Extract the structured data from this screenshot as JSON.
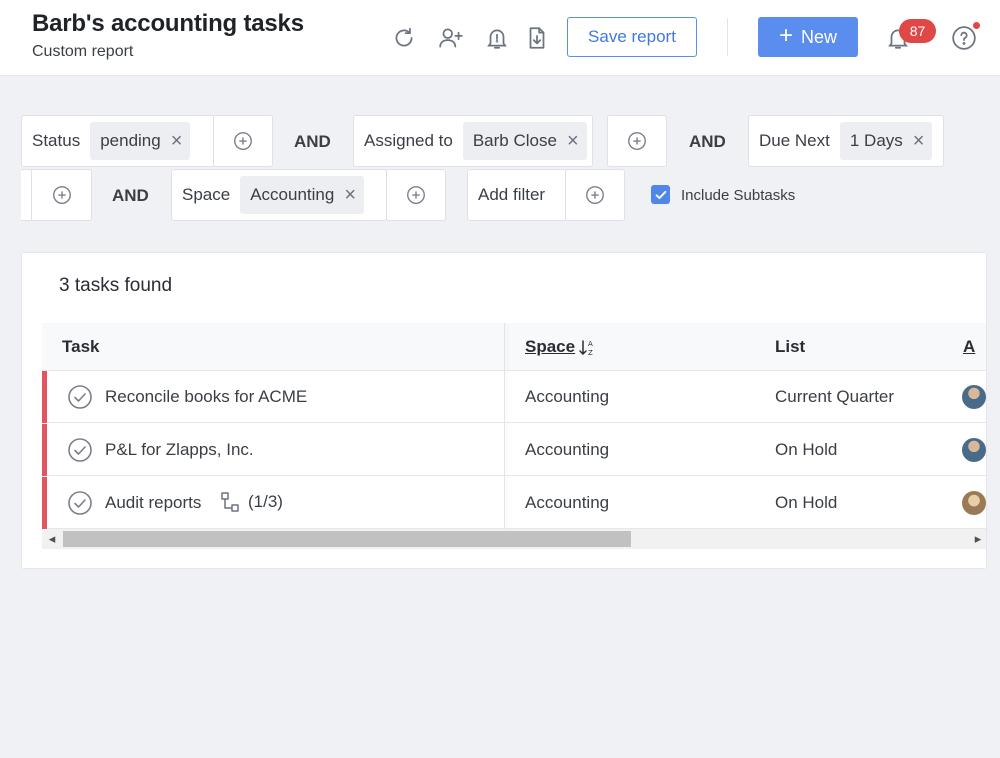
{
  "header": {
    "title": "Barb's accounting tasks",
    "subtitle": "Custom report",
    "save_label": "Save report",
    "new_label": "New",
    "notification_count": "87"
  },
  "filters": {
    "and_label": "AND",
    "status": {
      "label": "Status",
      "value": "pending"
    },
    "assigned": {
      "label": "Assigned to",
      "value": "Barb Close"
    },
    "due": {
      "label": "Due Next",
      "value": "1 Days"
    },
    "space": {
      "label": "Space",
      "value": "Accounting"
    },
    "add_filter_label": "Add filter",
    "include_subtasks_label": "Include Subtasks",
    "include_subtasks_checked": true
  },
  "results": {
    "summary": "3 tasks found",
    "columns": {
      "task": "Task",
      "space": "Space",
      "list": "List",
      "assignee": "A"
    },
    "rows": [
      {
        "task": "Reconcile books for ACME",
        "space": "Accounting",
        "list": "Current Quarter",
        "subtasks": ""
      },
      {
        "task": "P&L for Zlapps, Inc.",
        "space": "Accounting",
        "list": "On Hold",
        "subtasks": ""
      },
      {
        "task": "Audit reports",
        "space": "Accounting",
        "list": "On Hold",
        "subtasks": "(1/3)"
      }
    ]
  },
  "colors": {
    "accent": "#5b8def",
    "row_marker": "#e05561",
    "badge": "#e04848"
  }
}
